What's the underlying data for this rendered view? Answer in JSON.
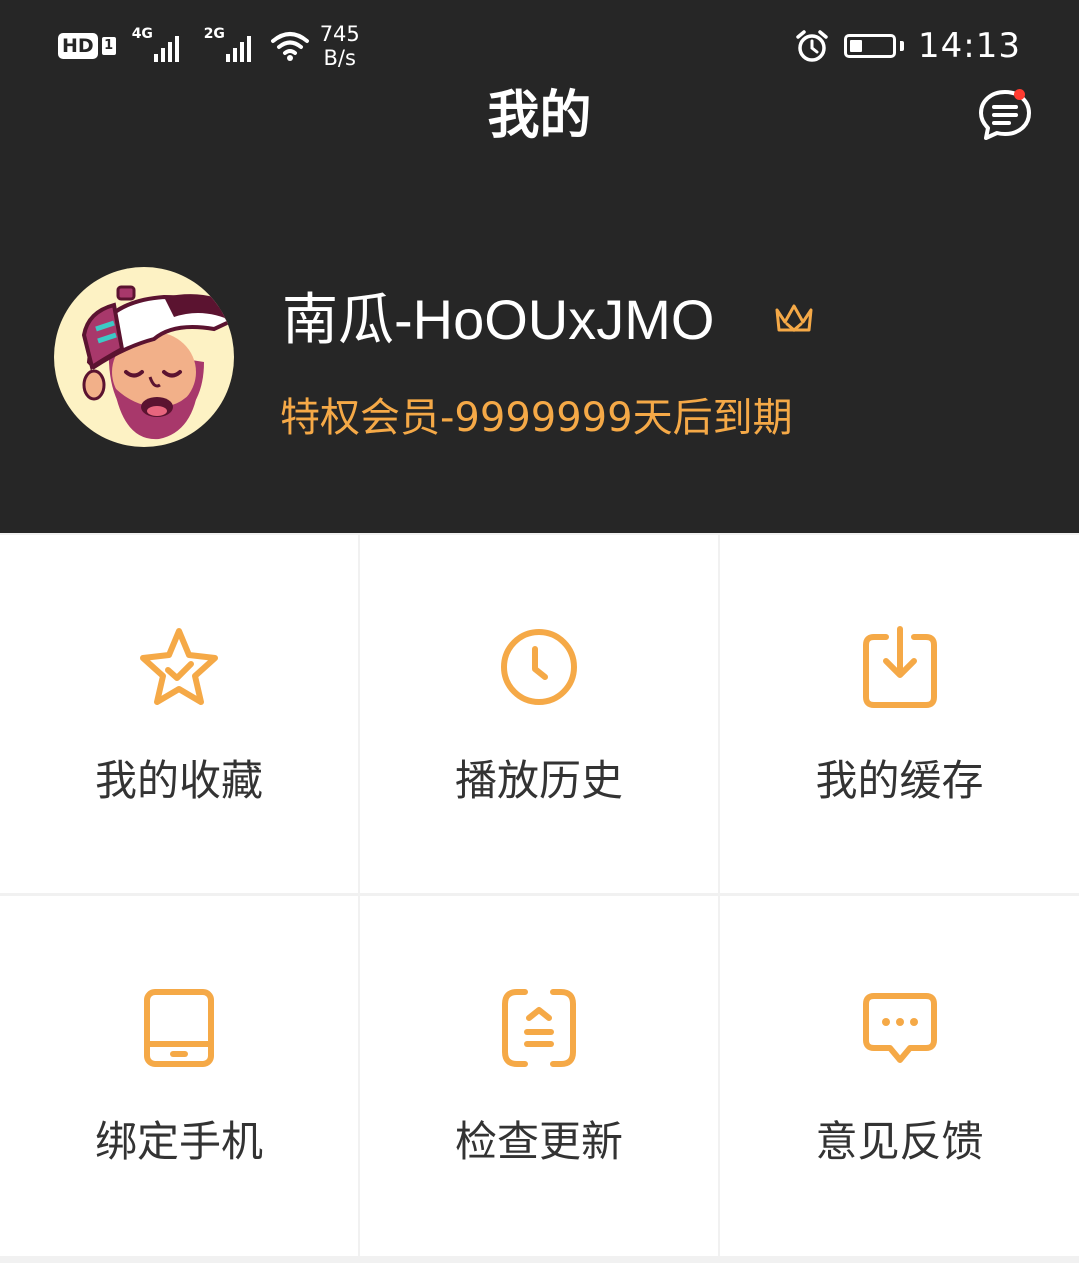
{
  "status_bar": {
    "hd": "HD",
    "sim": "1",
    "net1": "4G",
    "net2": "2G",
    "speed_value": "745",
    "speed_unit": "B/s",
    "battery_percent": 30,
    "time": "14:13"
  },
  "header": {
    "title": "我的",
    "message_icon": "chat-list-icon"
  },
  "profile": {
    "username": "南瓜-HoOUxJMO",
    "vip_icon": "crown-icon",
    "membership": "特权会员-9999999天后到期"
  },
  "menu": [
    {
      "label": "我的收藏",
      "icon": "star-check-icon"
    },
    {
      "label": "播放历史",
      "icon": "clock-icon"
    },
    {
      "label": "我的缓存",
      "icon": "download-box-icon"
    },
    {
      "label": "绑定手机",
      "icon": "tablet-icon"
    },
    {
      "label": "检查更新",
      "icon": "update-icon"
    },
    {
      "label": "意见反馈",
      "icon": "feedback-bubble-icon"
    }
  ],
  "colors": {
    "header_bg": "#262626",
    "accent": "#f5a947",
    "notification_dot": "#ff3b30"
  }
}
